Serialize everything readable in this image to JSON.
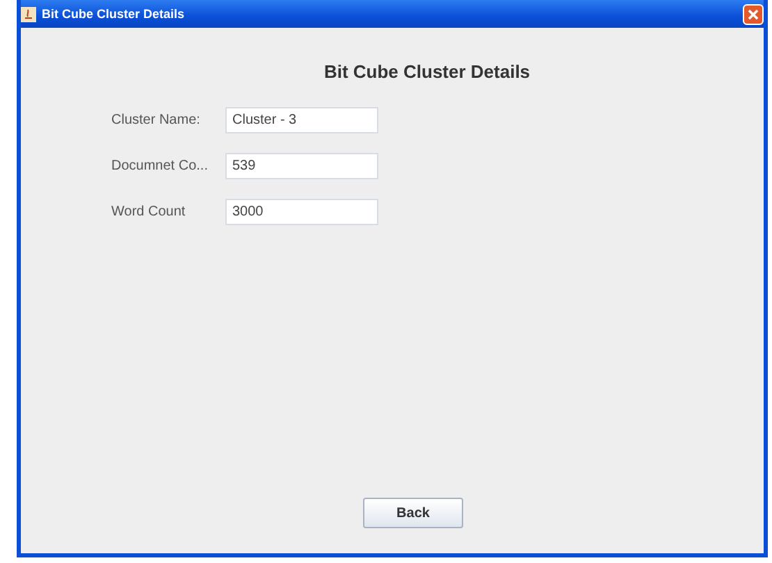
{
  "window": {
    "title": "Bit Cube Cluster Details"
  },
  "heading": "Bit Cube Cluster Details",
  "fields": [
    {
      "label": "Cluster Name:",
      "value": "Cluster - 3"
    },
    {
      "label": "Documnet Co...",
      "value": "539"
    },
    {
      "label": "Word Count",
      "value": "3000"
    }
  ],
  "buttons": [
    "Back"
  ]
}
